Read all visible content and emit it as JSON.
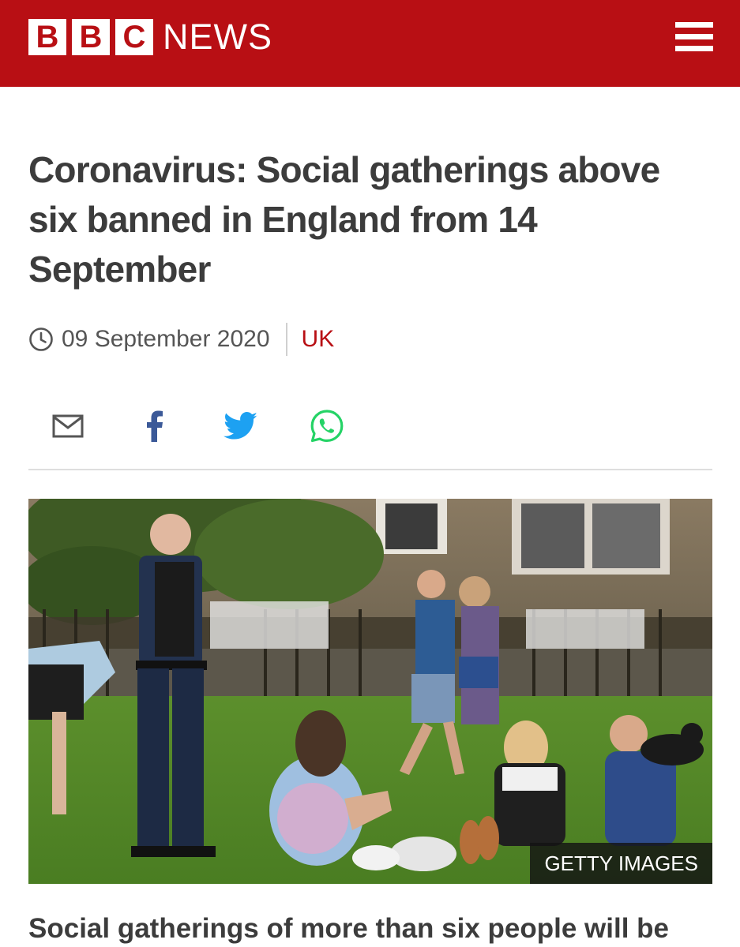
{
  "header": {
    "logo_letters": [
      "B",
      "B",
      "C"
    ],
    "logo_word": "NEWS",
    "menu_icon": "hamburger-menu-icon",
    "brand_color": "#b80f14"
  },
  "article": {
    "headline": "Coronavirus: Social gatherings above six banned in England from 14 September",
    "date": "09 September 2020",
    "section": "UK",
    "summary_visible": "Social gatherings of more than six people will be"
  },
  "share": {
    "icons": [
      "email-icon",
      "facebook-icon",
      "twitter-icon",
      "whatsapp-icon"
    ]
  },
  "image": {
    "credit": "GETTY IMAGES"
  },
  "colors": {
    "accent": "#b80f14",
    "text": "#3c3c3c",
    "facebook": "#3b5998",
    "twitter": "#1da1f2",
    "whatsapp": "#25d366"
  }
}
